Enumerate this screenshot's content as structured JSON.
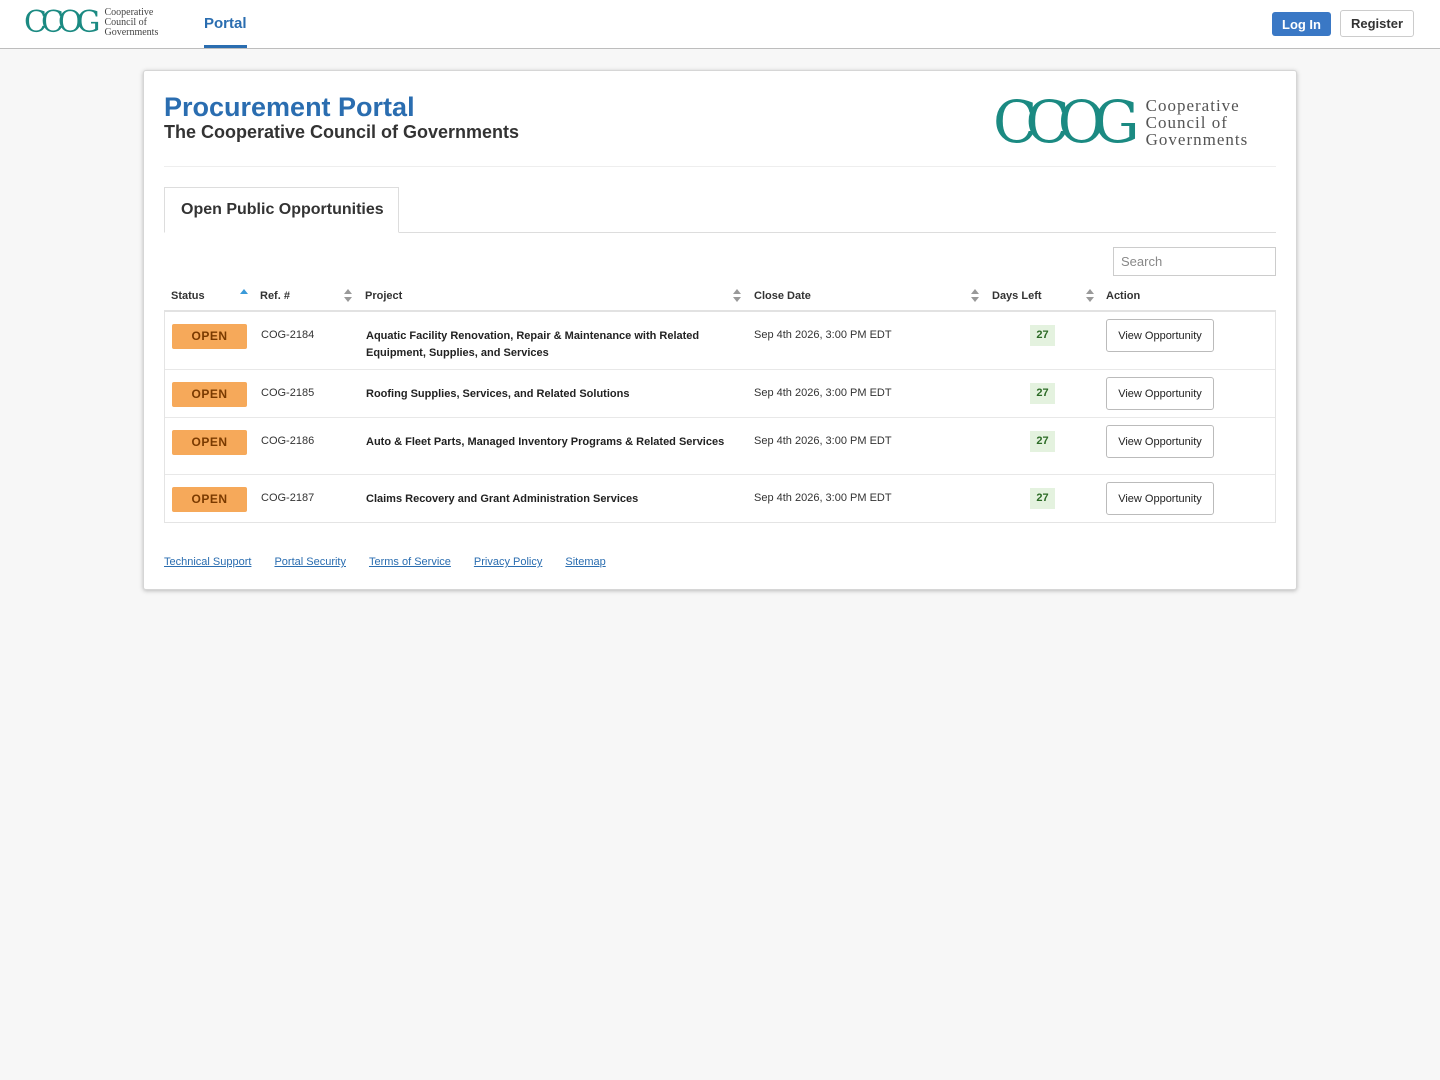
{
  "nav": {
    "logo_words": [
      "Cooperative",
      "Council of",
      "Governments"
    ],
    "logo_mark": "CCOG",
    "portal_label": "Portal",
    "login_label": "Log In",
    "register_label": "Register"
  },
  "header": {
    "title": "Procurement Portal",
    "subtitle": "The Cooperative Council of Governments",
    "logo_mark": "CCOG",
    "logo_words": [
      "Cooperative",
      "Council of",
      "Governments"
    ]
  },
  "tab": {
    "label": "Open Public Opportunities"
  },
  "search": {
    "placeholder": "Search"
  },
  "table": {
    "columns": [
      "Status",
      "Ref. #",
      "Project",
      "Close Date",
      "Days Left",
      "Action"
    ],
    "rows": [
      {
        "status": "OPEN",
        "ref": "COG-2184",
        "project": "Aquatic Facility Renovation, Repair & Maintenance with Related Equipment, Supplies, and Services",
        "close_date": "Sep 4th 2026, 3:00 PM EDT",
        "days_left": "27",
        "action": "View Opportunity"
      },
      {
        "status": "OPEN",
        "ref": "COG-2185",
        "project": "Roofing Supplies, Services, and Related Solutions",
        "close_date": "Sep 4th 2026, 3:00 PM EDT",
        "days_left": "27",
        "action": "View Opportunity"
      },
      {
        "status": "OPEN",
        "ref": "COG-2186",
        "project": "Auto & Fleet Parts, Managed Inventory Programs & Related Services",
        "close_date": "Sep 4th 2026, 3:00 PM EDT",
        "days_left": "27",
        "action": "View Opportunity"
      },
      {
        "status": "OPEN",
        "ref": "COG-2187",
        "project": "Claims Recovery and Grant Administration Services",
        "close_date": "Sep 4th 2026, 3:00 PM EDT",
        "days_left": "27",
        "action": "View Opportunity"
      }
    ]
  },
  "footer": {
    "links": [
      "Technical Support",
      "Portal Security",
      "Terms of Service",
      "Privacy Policy",
      "Sitemap"
    ]
  },
  "colors": {
    "brand_blue": "#2a6db0",
    "logo_teal": "#1b8a82",
    "status_open": "#f6a95a",
    "days_left_bg": "#e4f2df"
  }
}
